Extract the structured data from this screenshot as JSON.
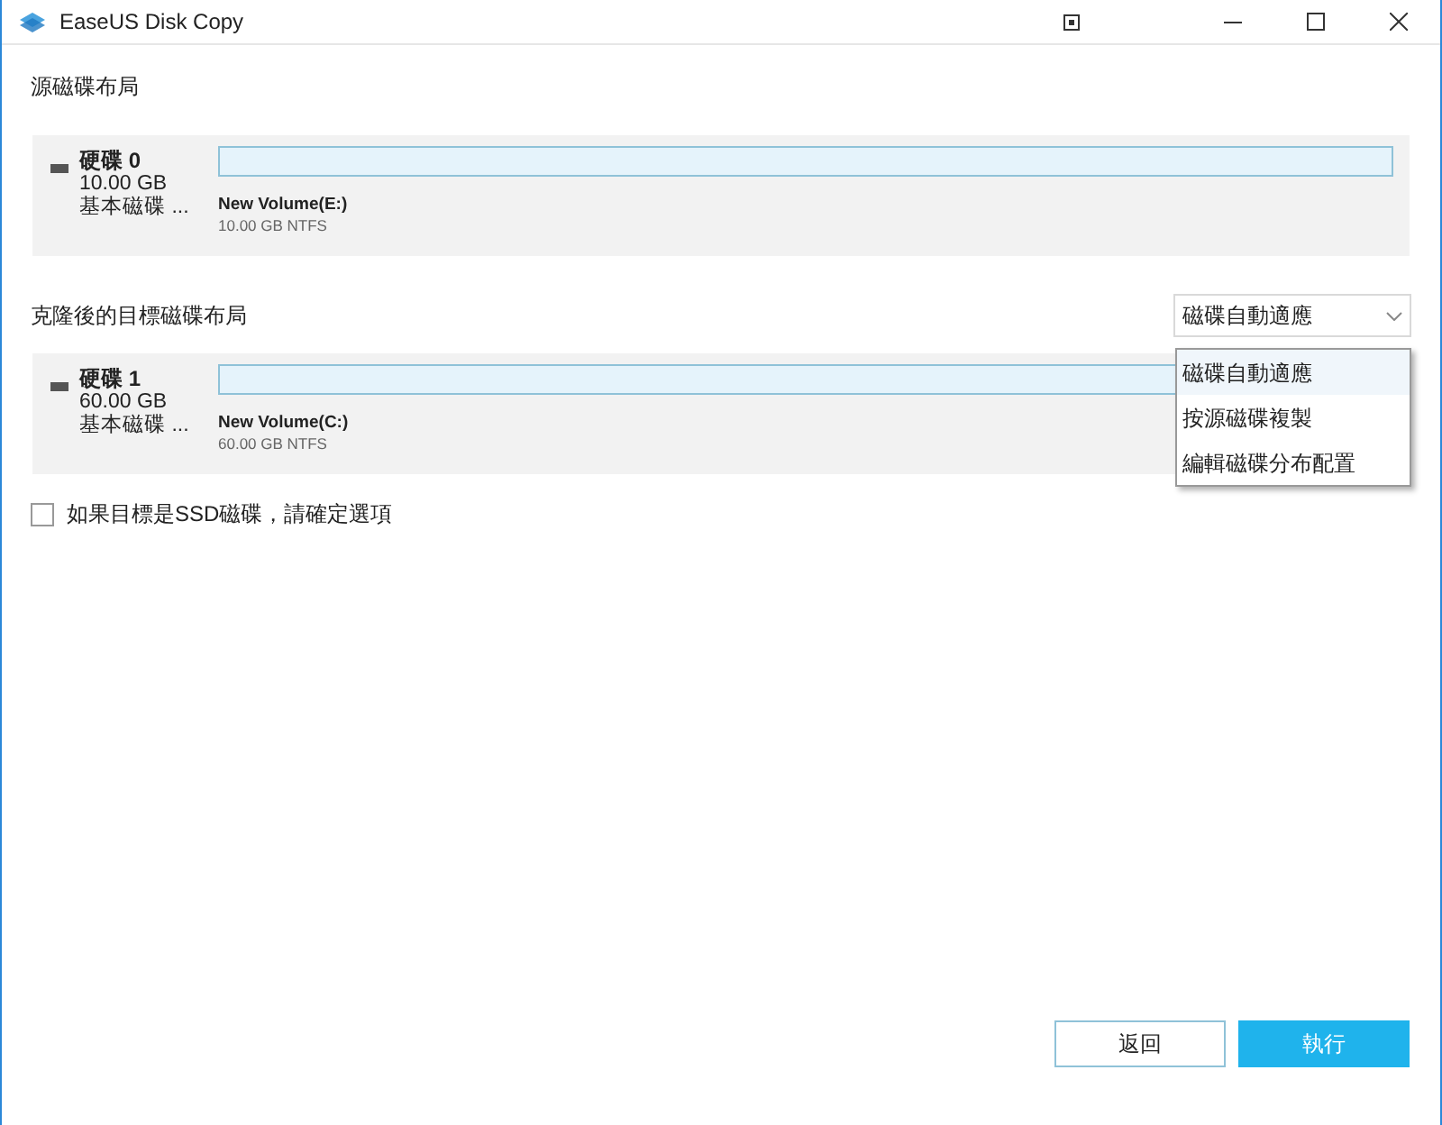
{
  "window": {
    "title": "EaseUS Disk Copy"
  },
  "source": {
    "heading": "源磁碟布局",
    "disk": {
      "name": "硬碟 0",
      "size": "10.00 GB",
      "type": "基本磁碟 ...",
      "volume": "New Volume(E:)",
      "volume_info": "10.00 GB NTFS"
    }
  },
  "target": {
    "heading": "克隆後的目標磁碟布局",
    "mode_dropdown": {
      "value": "磁碟自動適應",
      "expanded": true,
      "options": [
        {
          "label": "磁碟自動適應",
          "selected": true
        },
        {
          "label": "按源磁碟複製",
          "selected": false
        },
        {
          "label": "編輯磁碟分布配置",
          "selected": false
        }
      ]
    },
    "disk": {
      "name": "硬碟 1",
      "size": "60.00 GB",
      "type": "基本磁碟 ...",
      "volume": "New Volume(C:)",
      "volume_info": "60.00 GB NTFS"
    }
  },
  "ssd_option": {
    "label": "如果目標是SSD磁碟，請確定選項",
    "checked": false
  },
  "buttons": [
    {
      "label": "返回",
      "kind": "secondary"
    },
    {
      "label": "執行",
      "kind": "primary"
    }
  ]
}
